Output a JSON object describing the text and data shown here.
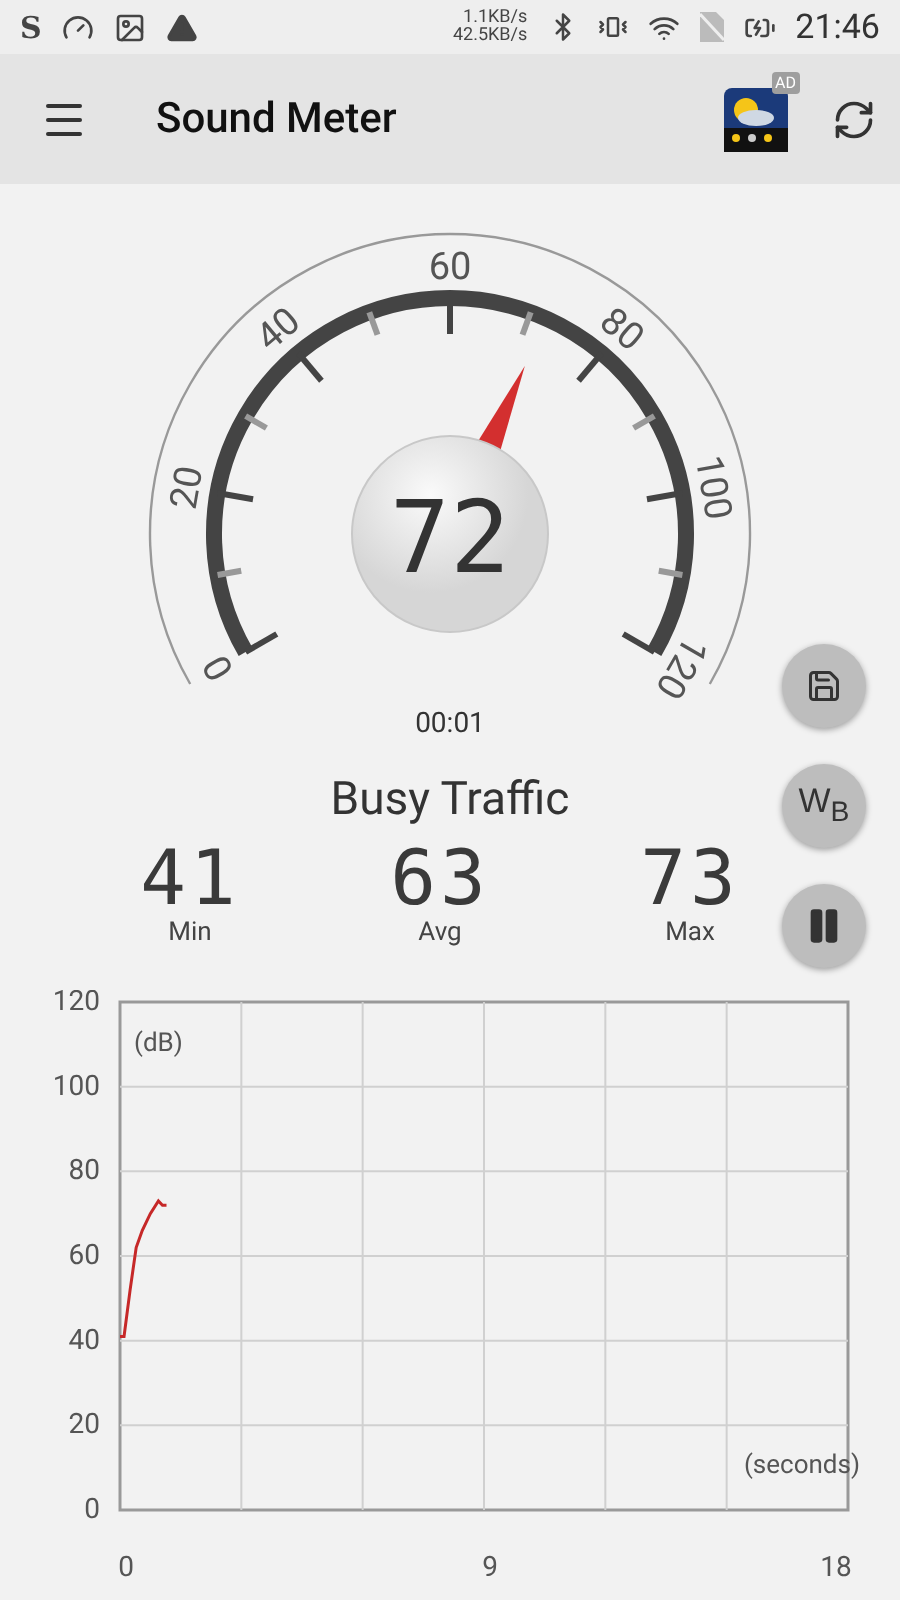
{
  "status_bar": {
    "app_mark": "S",
    "net_up": "1.1KB/s",
    "net_down": "42.5KB/s",
    "time": "21:46"
  },
  "app_bar": {
    "title": "Sound Meter",
    "ad_badge": "AD"
  },
  "gauge": {
    "labels": [
      "0",
      "20",
      "40",
      "60",
      "80",
      "100",
      "120"
    ],
    "reading": "72",
    "elapsed": "00:01"
  },
  "noise_class": "Busy Traffic",
  "stats": [
    {
      "value": "41",
      "label": "Min"
    },
    {
      "value": "63",
      "label": "Avg"
    },
    {
      "value": "73",
      "label": "Max"
    }
  ],
  "side_buttons": [
    {
      "kind": "save"
    },
    {
      "kind": "text",
      "label": "W$_{B}$"
    },
    {
      "kind": "pause"
    }
  ],
  "chart_data": {
    "type": "line",
    "grid": true,
    "xlabel": "(seconds)",
    "ylabel": "(dB)",
    "xlim": [
      0,
      18
    ],
    "ylim": [
      0,
      120
    ],
    "xticks": [
      0,
      9,
      18
    ],
    "yticks": [
      0,
      20,
      40,
      60,
      80,
      100,
      120
    ],
    "series": [
      {
        "color": "#c62828",
        "values": [
          41,
          41,
          52,
          62,
          66,
          70,
          73,
          72,
          72
        ]
      }
    ],
    "x": [
      0,
      0.1,
      0.25,
      0.4,
      0.55,
      0.75,
      0.95,
      1.05,
      1.15
    ]
  }
}
